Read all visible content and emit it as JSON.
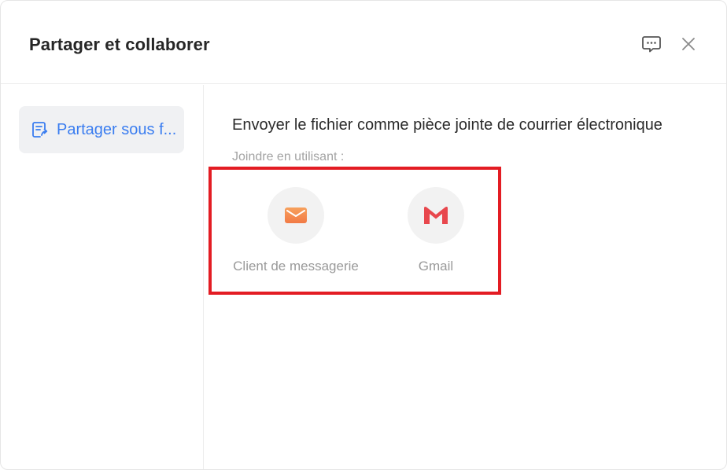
{
  "dialog": {
    "title": "Partager et collaborer",
    "feedback_icon": "chat-bubble-icon",
    "close_icon": "close-icon"
  },
  "sidebar": {
    "items": [
      {
        "label": "Partager sous f...",
        "icon": "document-share-icon",
        "selected": true
      }
    ]
  },
  "main": {
    "heading": "Envoyer le fichier comme pièce jointe de courrier électronique",
    "subheading": "Joindre en utilisant :",
    "options": [
      {
        "label": "Client de messagerie",
        "icon": "envelope-icon",
        "color": "#f5894e"
      },
      {
        "label": "Gmail",
        "icon": "gmail-icon",
        "color": "#e8474d"
      }
    ]
  },
  "colors": {
    "accent": "#3a7df0",
    "highlight": "#e31c23"
  }
}
